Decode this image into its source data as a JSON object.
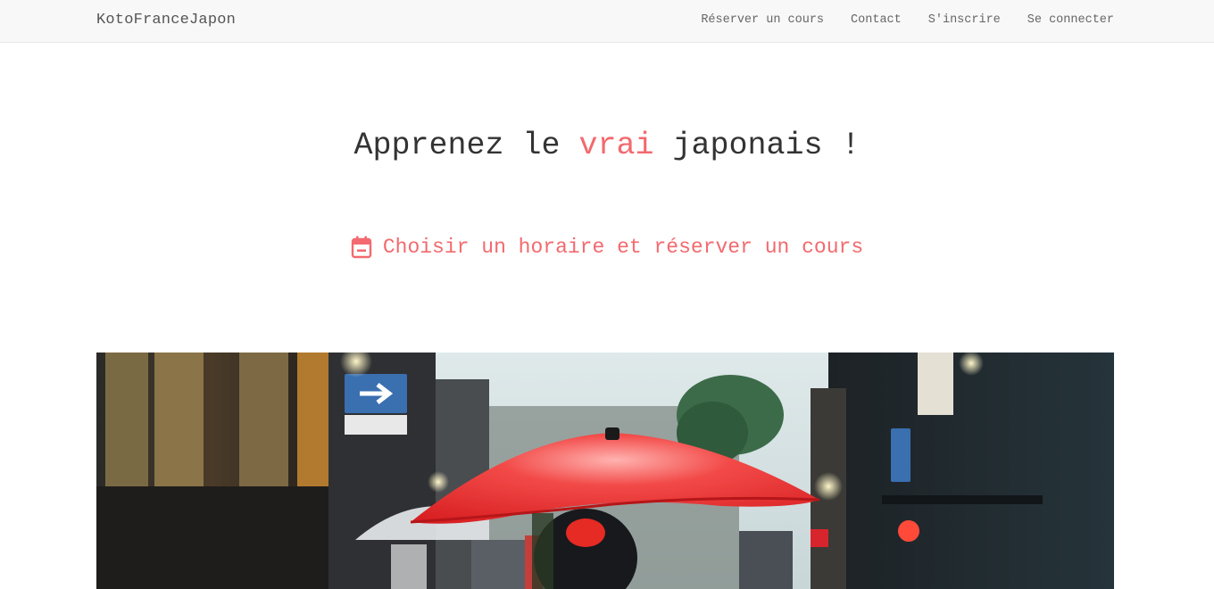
{
  "navbar": {
    "brand": "KotoFranceJapon",
    "links": [
      {
        "label": "Réserver un cours"
      },
      {
        "label": "Contact"
      },
      {
        "label": "S'inscrire"
      },
      {
        "label": "Se connecter"
      }
    ]
  },
  "hero": {
    "title_before": "Apprenez le ",
    "title_accent": "vrai",
    "title_after": " japonais !",
    "cta_label": "Choisir un horaire et réserver un cours",
    "cta_icon": "calendar-icon"
  },
  "colors": {
    "accent": "#f26a6f",
    "navbar_bg": "#f8f8f8",
    "text": "#333333"
  },
  "image": {
    "subject": "street-with-red-umbrella"
  }
}
